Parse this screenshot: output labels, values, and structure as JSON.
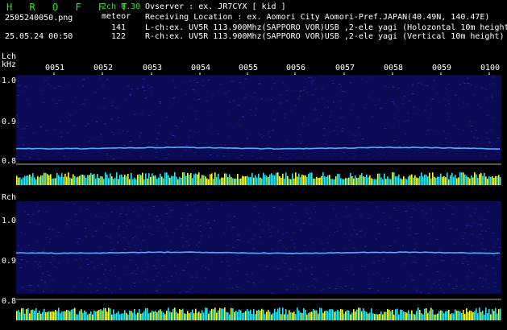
{
  "header": {
    "app_title": "H R O F F T",
    "version": "2ch 0.30",
    "mode": "meteor",
    "filename": "2505240050.png",
    "datetime": "25.05.24 00:50",
    "lch_count": "141",
    "rch_count": "122",
    "observer": "Ovserver          : ex. JR7CYX [ kid ]",
    "location": "Receiving Location : ex. Aomori City Aomori-Pref.JAPAN(40.49N, 140.47E)",
    "lch_info": "L-ch:ex. UV5R 113.900Mhz(SAPPORO VOR)USB ,2-ele yagi (Holozontal 10m height",
    "rch_info": "R-ch:ex. UV5R 113.900Mhz(SAPPORO VOR)USB ,2-ele yagi (Vertical 10m height)"
  },
  "lch": {
    "label": "Lch",
    "unit": "kHz",
    "ticks": [
      "1.0",
      "0.9",
      "0.8"
    ]
  },
  "rch": {
    "label": "Rch",
    "ticks": [
      "1.0",
      "0.9",
      "0.8"
    ]
  },
  "time_ticks": [
    "0051",
    "0052",
    "0053",
    "0054",
    "0055",
    "0056",
    "0057",
    "0058",
    "0059",
    "0100"
  ],
  "colors": {
    "background": "#000000",
    "spectrogram": "#0a0a55",
    "signal": "#55aaff",
    "power_cyan": "#33e0f0",
    "power_yellow": "#ffff33",
    "title_green": "#33dd33"
  }
}
